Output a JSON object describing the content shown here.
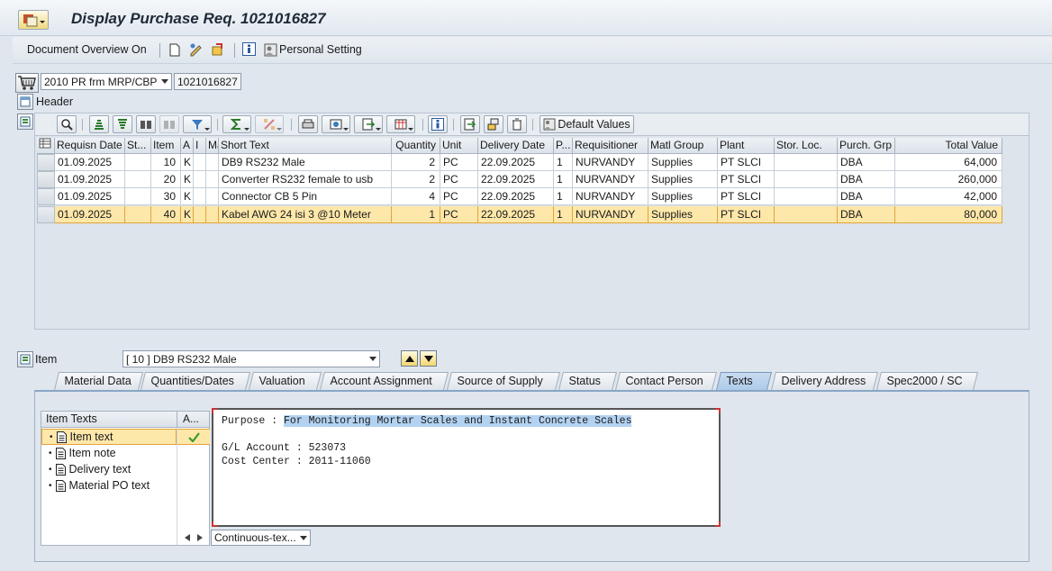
{
  "title": "Display Purchase Req. 1021016827",
  "toolbar": {
    "doc_overview_label": "Document Overview On",
    "personal_setting_label": "Personal Setting"
  },
  "doc": {
    "type_value": "2010 PR frm MRP/CBP",
    "number_value": "1021016827",
    "header_label": "Header"
  },
  "grid_toolbar": {
    "default_values_label": "Default Values"
  },
  "grid": {
    "columns": [
      "Requisn Date",
      "St...",
      "Item",
      "A",
      "I",
      "Ma",
      "Short Text",
      "Quantity",
      "Unit",
      "Delivery Date",
      "P...",
      "Requisitioner",
      "Matl Group",
      "Plant",
      "Stor. Loc.",
      "Purch. Grp",
      "Total Value"
    ],
    "rows": [
      {
        "date": "01.09.2025",
        "st": "",
        "item": "10",
        "a": "K",
        "i": "",
        "ma": "",
        "short_text": "DB9 RS232 Male",
        "qty": "2",
        "unit": "PC",
        "delivery": "22.09.2025",
        "p": "1",
        "req": "NURVANDY",
        "matl": "Supplies",
        "plant": "PT SLCI",
        "stor": "",
        "pgrp": "DBA",
        "total": "64,000"
      },
      {
        "date": "01.09.2025",
        "st": "",
        "item": "20",
        "a": "K",
        "i": "",
        "ma": "",
        "short_text": "Converter RS232 female to usb",
        "qty": "2",
        "unit": "PC",
        "delivery": "22.09.2025",
        "p": "1",
        "req": "NURVANDY",
        "matl": "Supplies",
        "plant": "PT SLCI",
        "stor": "",
        "pgrp": "DBA",
        "total": "260,000"
      },
      {
        "date": "01.09.2025",
        "st": "",
        "item": "30",
        "a": "K",
        "i": "",
        "ma": "",
        "short_text": "Connector CB 5 Pin",
        "qty": "4",
        "unit": "PC",
        "delivery": "22.09.2025",
        "p": "1",
        "req": "NURVANDY",
        "matl": "Supplies",
        "plant": "PT SLCI",
        "stor": "",
        "pgrp": "DBA",
        "total": "42,000"
      },
      {
        "date": "01.09.2025",
        "st": "",
        "item": "40",
        "a": "K",
        "i": "",
        "ma": "",
        "short_text": "Kabel AWG 24 isi 3 @10 Meter",
        "qty": "1",
        "unit": "PC",
        "delivery": "22.09.2025",
        "p": "1",
        "req": "NURVANDY",
        "matl": "Supplies",
        "plant": "PT SLCI",
        "stor": "",
        "pgrp": "DBA",
        "total": "80,000"
      }
    ]
  },
  "item": {
    "label": "Item",
    "selected": "[ 10 ] DB9 RS232 Male"
  },
  "tabs": [
    "Material Data",
    "Quantities/Dates",
    "Valuation",
    "Account Assignment",
    "Source of Supply",
    "Status",
    "Contact Person",
    "Texts",
    "Delivery Address",
    "Spec2000 / SC"
  ],
  "texts": {
    "list_header": "Item Texts",
    "col2_header": "A...",
    "items": [
      "Item text",
      "Item note",
      "Delivery text",
      "Material PO text"
    ],
    "format_value": "Continuous-tex...",
    "editor": {
      "line1_prefix": "Purpose : ",
      "line1_value": "For Monitoring Mortar Scales and Instant Concrete Scales",
      "line2": "G/L Account : 523073",
      "line3": "Cost Center : 2011-11060"
    }
  }
}
